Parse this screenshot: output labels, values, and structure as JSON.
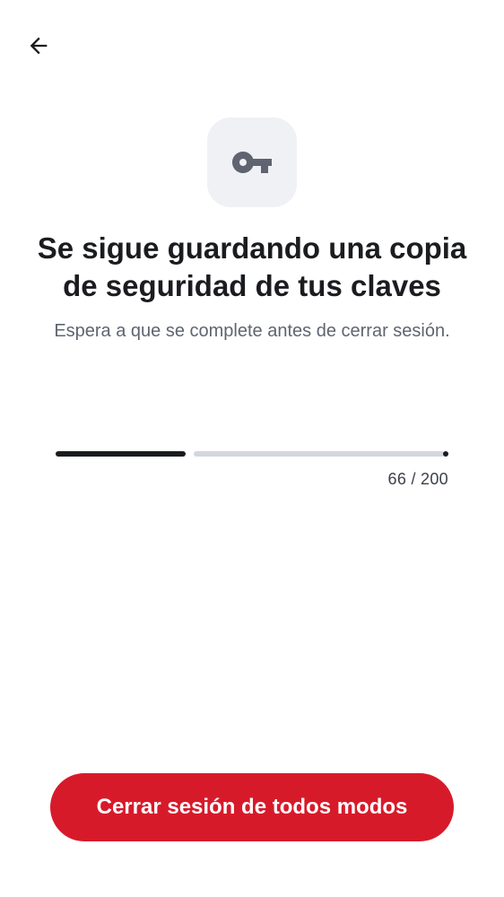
{
  "header": {
    "back_icon": "arrow-left-icon"
  },
  "hero": {
    "icon": "key-icon"
  },
  "content": {
    "title": "Se sigue guardando una copia de seguridad de tus claves",
    "subtitle": "Espera a que se complete antes de cerrar sesión."
  },
  "progress": {
    "current": 66,
    "total": 200,
    "label": "66 / 200"
  },
  "actions": {
    "signout_label": "Cerrar sesión de todos modos"
  },
  "colors": {
    "accent": "#d71a2a",
    "text_primary": "#1b1c1f",
    "text_secondary": "#5f6470",
    "track": "#d3d7de",
    "icon_badge_bg": "#f0f1f5"
  }
}
